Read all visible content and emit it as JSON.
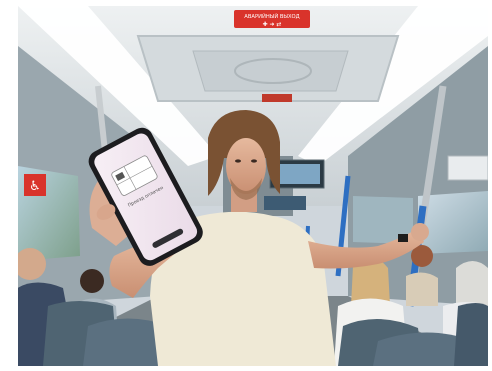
{
  "photo": {
    "scene": "bus-interior",
    "ceiling_sign": {
      "text": "АВАРИЙНЫЙ ВЫХОД",
      "color": "#d9332b"
    },
    "phone_screen": {
      "title": "Проезд оплачен",
      "subtitle": "",
      "background": "#f1e7f0"
    },
    "colors": {
      "ceiling": "#dfe4e6",
      "handrail_blue": "#2e6fc2",
      "seat": "#4f6472",
      "shirt": "#efe9d6"
    }
  }
}
